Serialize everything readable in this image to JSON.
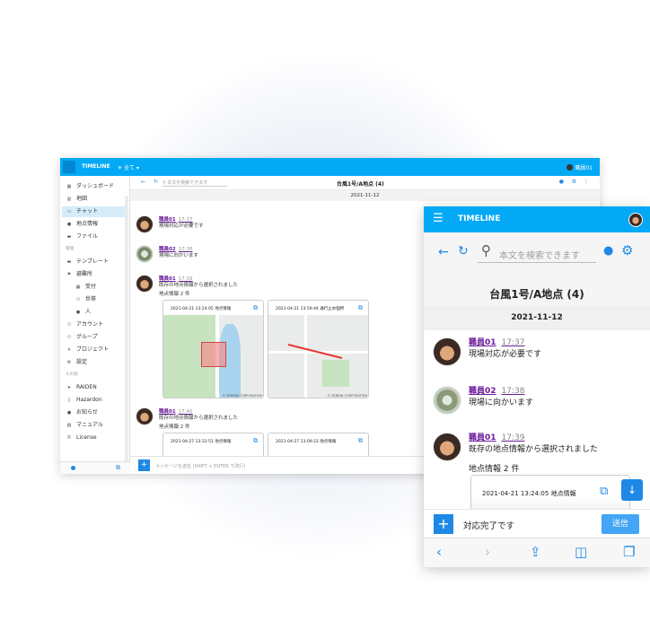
{
  "desktop": {
    "app_title": "TIMELINE",
    "scope_label": "全て",
    "user_name": "職員01",
    "sidebar": {
      "items": [
        {
          "icon": "dashboard-icon",
          "glyph": "▦",
          "label": "ダッシュボード"
        },
        {
          "icon": "map-icon",
          "glyph": "▥",
          "label": "地図"
        },
        {
          "icon": "chat-icon",
          "glyph": "▭",
          "label": "チャット"
        },
        {
          "icon": "pin-icon",
          "glyph": "●",
          "label": "地点情報"
        },
        {
          "icon": "folder-icon",
          "glyph": "▬",
          "label": "ファイル"
        },
        {
          "icon": "template-icon",
          "glyph": "▬",
          "label": "テンプレート"
        },
        {
          "icon": "flag-icon",
          "glyph": "⚑",
          "label": "避難所"
        },
        {
          "icon": "desk-icon",
          "glyph": "▦",
          "label": "受付"
        },
        {
          "icon": "people-icon",
          "glyph": "⚇",
          "label": "世帯"
        },
        {
          "icon": "person-icon",
          "glyph": "●",
          "label": "人"
        },
        {
          "icon": "account-icon",
          "glyph": "⚇",
          "label": "アカウント"
        },
        {
          "icon": "group-icon",
          "glyph": "⚇",
          "label": "グループ"
        },
        {
          "icon": "project-icon",
          "glyph": "✈",
          "label": "プロジェクト"
        },
        {
          "icon": "gear-icon",
          "glyph": "⚙",
          "label": "設定"
        },
        {
          "icon": "raiden-icon",
          "glyph": "➤",
          "label": "RAIDEN"
        },
        {
          "icon": "hazardon-icon",
          "glyph": "▯",
          "label": "Hazardon"
        },
        {
          "icon": "notice-icon",
          "glyph": "●",
          "label": "お知らせ"
        },
        {
          "icon": "manual-icon",
          "glyph": "▧",
          "label": "マニュアル"
        },
        {
          "icon": "license-icon",
          "glyph": "©",
          "label": "License"
        }
      ],
      "section_admin": "管理",
      "section_other": "その他"
    },
    "search_placeholder": "本文を検索できます",
    "chat_title": "台風1号/A地点 (4)",
    "date_divider": "2021-11-12",
    "messages": [
      {
        "name": "職員01",
        "time": "17:37",
        "text": "現場対応が必要です"
      },
      {
        "name": "職員02",
        "time": "17:38",
        "text": "現場に向かいます"
      },
      {
        "name": "職員01",
        "time": "17:39",
        "text": "既存の地点情報から選択されました",
        "text2": "地点情報 2 件"
      },
      {
        "name": "職員01",
        "time": "17:40",
        "text": "既存の地点情報から選択されました",
        "text2": "地点情報 2 件"
      }
    ],
    "cards": [
      {
        "title": "2021-04-21 13:24:05 地点情報"
      },
      {
        "title": "2021-04-21 13:59:44 通行止め個所"
      },
      {
        "title": "2021-04-27 13:22:51 地点情報"
      },
      {
        "title": "2021-04-27 13:09:23 地点情報"
      }
    ],
    "map_copyright": "© ZENRIN CORPORATION",
    "input_placeholder": "メッセージを送信 (SHIFT + ENTER で改行)"
  },
  "mobile": {
    "app_title": "TIMELINE",
    "search_placeholder": "本文を検索できます",
    "chat_title": "台風1号/A地点 (4)",
    "date_divider": "2021-11-12",
    "messages": [
      {
        "name": "職員01",
        "time": "17:37",
        "text": "現場対応が必要です"
      },
      {
        "name": "職員02",
        "time": "17:38",
        "text": "現場に向かいます"
      },
      {
        "name": "職員01",
        "time": "17:39",
        "text": "既存の地点情報から選択されました",
        "text2": "地点情報 2 件"
      }
    ],
    "card_title": "2021-04-21 13:24:05 地点情報",
    "input_value": "対応完了です",
    "send_label": "送信"
  },
  "colors": {
    "accent": "#03a9f4",
    "button": "#1e88e5",
    "username": "#6a1b9a"
  }
}
